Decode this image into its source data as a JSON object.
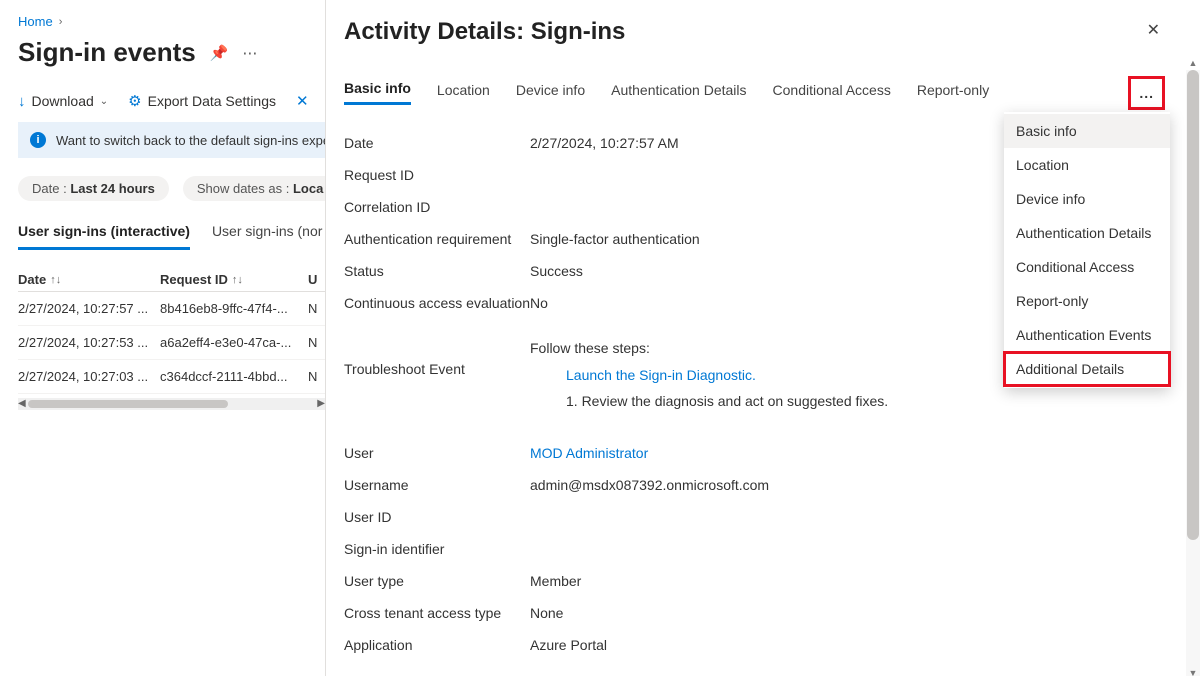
{
  "breadcrumb": {
    "home": "Home"
  },
  "page_title": "Sign-in events",
  "cmd": {
    "download": "Download",
    "export": "Export Data Settings"
  },
  "banner": "Want to switch back to the default sign-ins experi",
  "filters": {
    "date_label": "Date :",
    "date_value": "Last 24 hours",
    "show_label": "Show dates as :",
    "show_value": "Loca"
  },
  "subtabs": {
    "interactive": "User sign-ins (interactive)",
    "noninteractive": "User sign-ins (nor"
  },
  "table": {
    "headers": {
      "date": "Date",
      "request_id": "Request ID",
      "u": "U"
    },
    "rows": [
      {
        "date": "2/27/2024, 10:27:57 ...",
        "req": "8b416eb8-9ffc-47f4-...",
        "trail": "N"
      },
      {
        "date": "2/27/2024, 10:27:53 ...",
        "req": "a6a2eff4-e3e0-47ca-...",
        "trail": "N"
      },
      {
        "date": "2/27/2024, 10:27:03 ...",
        "req": "c364dccf-2111-4bbd...",
        "trail": "N"
      }
    ]
  },
  "panel_title": "Activity Details: Sign-ins",
  "tabs": [
    "Basic info",
    "Location",
    "Device info",
    "Authentication Details",
    "Conditional Access",
    "Report-only"
  ],
  "details": {
    "date_l": "Date",
    "date_v": "2/27/2024, 10:27:57 AM",
    "reqid_l": "Request ID",
    "reqid_v": "",
    "corr_l": "Correlation ID",
    "corr_v": "",
    "auth_l": "Authentication requirement",
    "auth_v": "Single-factor authentication",
    "status_l": "Status",
    "status_v": "Success",
    "cae_l": "Continuous access evaluation",
    "cae_v": "No",
    "trouble_l": "Troubleshoot Event",
    "trouble_intro": "Follow these steps:",
    "trouble_link": "Launch the Sign-in Diagnostic.",
    "trouble_step1": "1. Review the diagnosis and act on suggested fixes.",
    "user_l": "User",
    "user_v": "MOD Administrator",
    "username_l": "Username",
    "username_v": "admin@msdx087392.onmicrosoft.com",
    "userid_l": "User ID",
    "userid_v": "",
    "signid_l": "Sign-in identifier",
    "signid_v": "",
    "usertype_l": "User type",
    "usertype_v": "Member",
    "cross_l": "Cross tenant access type",
    "cross_v": "None",
    "app_l": "Application",
    "app_v": "Azure Portal"
  },
  "menu": [
    "Basic info",
    "Location",
    "Device info",
    "Authentication Details",
    "Conditional Access",
    "Report-only",
    "Authentication Events",
    "Additional Details"
  ]
}
